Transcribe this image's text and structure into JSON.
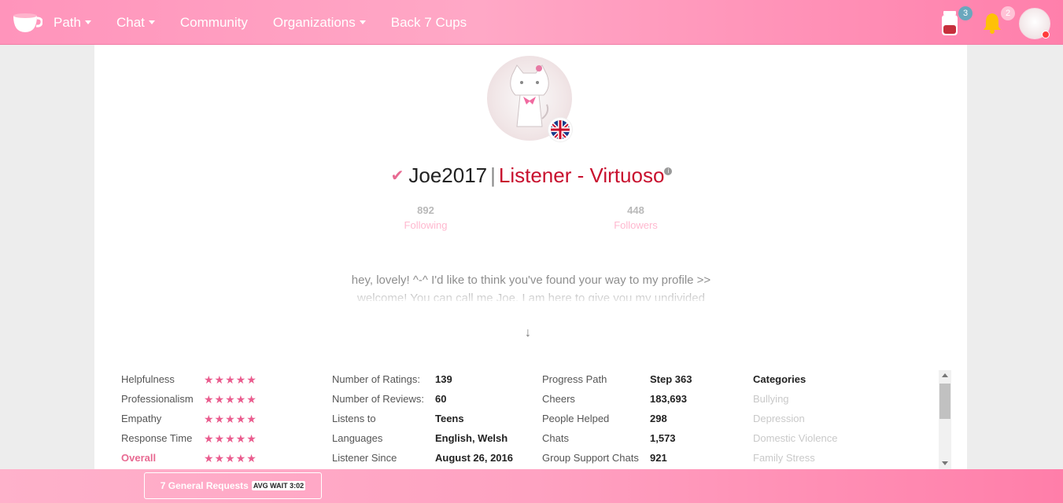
{
  "nav": {
    "items": [
      {
        "label": "Path",
        "caret": true
      },
      {
        "label": "Chat",
        "caret": true
      },
      {
        "label": "Community",
        "caret": false
      },
      {
        "label": "Organizations",
        "caret": true
      },
      {
        "label": "Back 7 Cups",
        "caret": false
      }
    ],
    "jar_badge": "3",
    "bell_badge": "2"
  },
  "profile": {
    "username": "Joe2017",
    "separator": "|",
    "role": "Listener - Virtuoso",
    "following_count": "892",
    "following_label": "Following",
    "followers_count": "448",
    "followers_label": "Followers",
    "bio": "hey, lovely! ^-^ I'd like to think you've found your way to my profile >> welcome! You can call me Joe. I am here to give you my undivided"
  },
  "ratings": [
    {
      "label": "Helpfulness",
      "stars": 5
    },
    {
      "label": "Professionalism",
      "stars": 5
    },
    {
      "label": "Empathy",
      "stars": 5
    },
    {
      "label": "Response Time",
      "stars": 5
    },
    {
      "label": "Overall",
      "stars": 5
    }
  ],
  "details": [
    {
      "label": "Number of Ratings:",
      "value": "139"
    },
    {
      "label": "Number of Reviews:",
      "value": "60"
    },
    {
      "label": "Listens to",
      "value": "Teens"
    },
    {
      "label": "Languages",
      "value": "English, Welsh"
    },
    {
      "label": "Listener Since",
      "value": "August 26, 2016"
    }
  ],
  "progress": [
    {
      "label": "Progress Path",
      "value": "Step 363"
    },
    {
      "label": "Cheers",
      "value": "183,693"
    },
    {
      "label": "People Helped",
      "value": "298"
    },
    {
      "label": "Chats",
      "value": "1,573"
    },
    {
      "label": "Group Support Chats",
      "value": "921"
    }
  ],
  "categories": {
    "title": "Categories",
    "items": [
      "Bullying",
      "Depression",
      "Domestic Violence",
      "Family Stress"
    ]
  },
  "footer": {
    "requests_label": "7 General Requests",
    "wait_label": "AVG WAIT 3:02"
  }
}
